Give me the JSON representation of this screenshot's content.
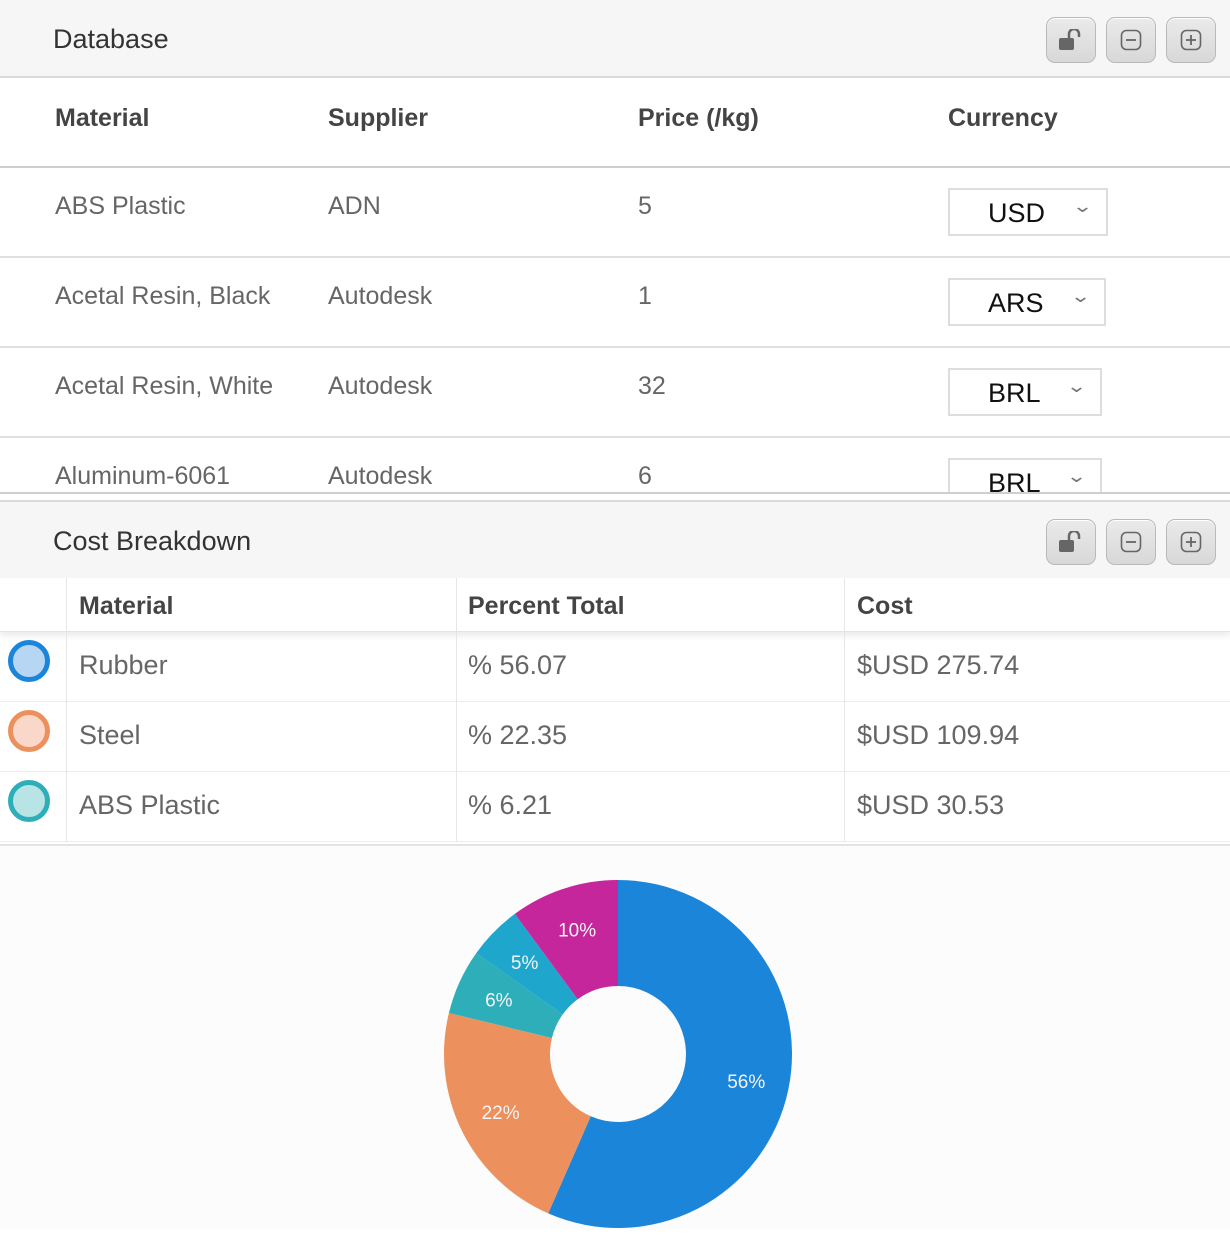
{
  "database": {
    "title": "Database",
    "headers": {
      "material": "Material",
      "supplier": "Supplier",
      "price": "Price (/kg)",
      "currency": "Currency"
    },
    "rows": [
      {
        "material": "ABS Plastic",
        "supplier": "ADN",
        "price": "5",
        "currency": "USD"
      },
      {
        "material": "Acetal Resin, Black",
        "supplier": "Autodesk",
        "price": "1",
        "currency": "ARS"
      },
      {
        "material": "Acetal Resin, White",
        "supplier": "Autodesk",
        "price": "32",
        "currency": "BRL"
      },
      {
        "material": "Aluminum-6061",
        "supplier": "Autodesk",
        "price": "6",
        "currency": "BRL"
      }
    ]
  },
  "cost_breakdown": {
    "title": "Cost Breakdown",
    "headers": {
      "material": "Material",
      "percent": "Percent Total",
      "cost": "Cost"
    },
    "rows": [
      {
        "material": "Rubber",
        "percent": "% 56.07",
        "cost": "$USD 275.74",
        "color": "#1a85d9",
        "fill": "#b7d6f3"
      },
      {
        "material": "Steel",
        "percent": "% 22.35",
        "cost": "$USD 109.94",
        "color": "#ec915d",
        "fill": "#fad8c9"
      },
      {
        "material": "ABS Plastic",
        "percent": "% 6.21",
        "cost": "$USD 30.53",
        "color": "#2eaeb9",
        "fill": "#b8e4e6"
      }
    ]
  },
  "header_icons": [
    "unlock-icon",
    "minimize-icon",
    "maximize-icon"
  ],
  "chart_data": {
    "type": "pie",
    "donut": true,
    "slices": [
      {
        "value": 56,
        "label": "56%",
        "color": "#1a85d9"
      },
      {
        "value": 22,
        "label": "22%",
        "color": "#ec915d"
      },
      {
        "value": 6,
        "label": "6%",
        "color": "#2eaeb9"
      },
      {
        "value": 5,
        "label": "5%",
        "color": "#1fa6cc"
      },
      {
        "value": 10,
        "label": "10%",
        "color": "#c5269b"
      }
    ]
  }
}
